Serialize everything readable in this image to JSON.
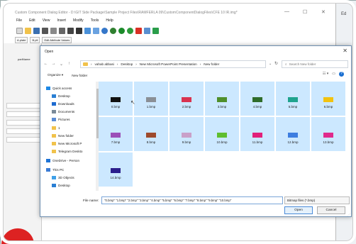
{
  "app": {
    "title": "Custom Component Dialog Editor - D:\\GIT Side Package\\Sample Project Files\\RAMFERLA 09\\CustomComponentDialogFiles\\CFE 10 IR.img*",
    "menu": [
      "File",
      "Edit",
      "View",
      "Insert",
      "Modify",
      "Tools",
      "Help"
    ],
    "tabs": [
      "A.plate",
      "B.plt",
      "Edit Attribute Values"
    ],
    "side_label": "partName",
    "right_panel_title": "Ed"
  },
  "dialog": {
    "title": "Open",
    "breadcrumb": [
      "vahab abbasi",
      "Desktop",
      "New Microsoft PowerPoint Presentation",
      "New folder"
    ],
    "search_placeholder": "Search New folder",
    "organize_label": "Organize ▾",
    "new_folder_label": "New folder",
    "nav_items": [
      {
        "label": "Quick access",
        "icon": "star-icon",
        "color": "#1e88e5"
      },
      {
        "label": "Desktop",
        "icon": "desktop-icon",
        "color": "#2a7fd4",
        "pinned": true
      },
      {
        "label": "Downloads",
        "icon": "download-icon",
        "color": "#1e6bd0",
        "pinned": true
      },
      {
        "label": "Documents",
        "icon": "documents-icon",
        "color": "#7a8a99",
        "pinned": true
      },
      {
        "label": "Pictures",
        "icon": "pictures-icon",
        "color": "#5b8dd6",
        "pinned": true
      },
      {
        "label": "1",
        "icon": "folder-icon",
        "color": "#f1c24b"
      },
      {
        "label": "New folder",
        "icon": "folder-icon",
        "color": "#f1c24b"
      },
      {
        "label": "New Microsoft P",
        "icon": "folder-icon",
        "color": "#f1c24b"
      },
      {
        "label": "Telegram Deskto",
        "icon": "folder-icon",
        "color": "#f1c24b"
      },
      {
        "label": "OneDrive - Person",
        "icon": "cloud-icon",
        "color": "#1e73d6"
      },
      {
        "label": "This PC",
        "icon": "pc-icon",
        "color": "#3a7bd5"
      },
      {
        "label": "3D Objects",
        "icon": "cube-icon",
        "color": "#3fa0e8"
      },
      {
        "label": "Desktop",
        "icon": "desktop-icon",
        "color": "#2a7fd4"
      }
    ],
    "files": [
      {
        "name": "0.bmp",
        "color": "#111111"
      },
      {
        "name": "1.bmp",
        "color": "#8a8f96"
      },
      {
        "name": "2.bmp",
        "color": "#d9334f"
      },
      {
        "name": "3.bmp",
        "color": "#4f8f2a"
      },
      {
        "name": "4.bmp",
        "color": "#2f6c2a"
      },
      {
        "name": "5.bmp",
        "color": "#1ea38e"
      },
      {
        "name": "6.bmp",
        "color": "#f2c20f"
      },
      {
        "name": "7.bmp",
        "color": "#9b4fb8"
      },
      {
        "name": "8.bmp",
        "color": "#9e4a2c"
      },
      {
        "name": "9.bmp",
        "color": "#c9a0c9"
      },
      {
        "name": "10.bmp",
        "color": "#5fbe2e"
      },
      {
        "name": "11.bmp",
        "color": "#e2207a"
      },
      {
        "name": "12.bmp",
        "color": "#3d7de0"
      },
      {
        "name": "13.bmp",
        "color": "#e02a8c"
      },
      {
        "name": "14.bmp",
        "color": "#2b1d8c"
      }
    ],
    "file_name_label": "File name:",
    "file_name_value": "\"0.bmp\" \"1.bmp\" \"2.bmp\" \"3.bmp\" \"4.bmp\" \"5.bmp\" \"6.bmp\" \"7.bmp\" \"8.bmp\" \"9.bmp\" \"10.bmp\"",
    "file_type": "Bitmap files (*.bmp)",
    "open_label": "Open",
    "cancel_label": "Cancel"
  }
}
